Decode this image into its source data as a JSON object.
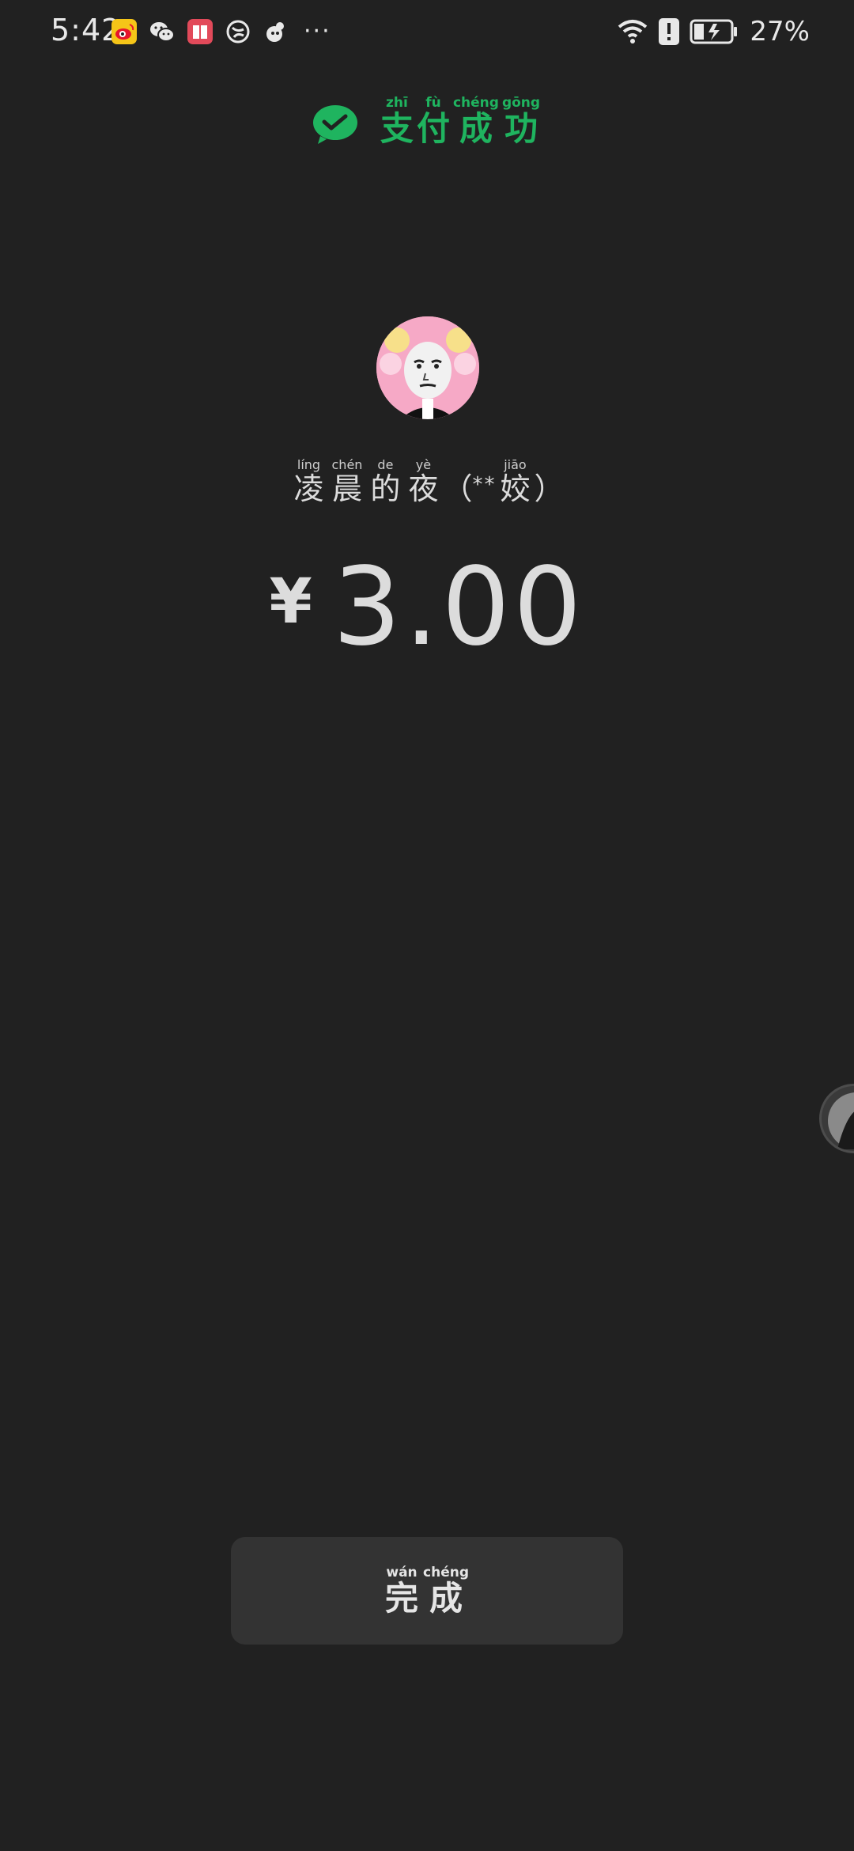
{
  "status_bar": {
    "time": "5:42",
    "more": "···",
    "battery_percent": "27%",
    "notification_icons": [
      "weibo-icon",
      "wechat-icon",
      "reader-icon",
      "browser-icon",
      "app-icon"
    ],
    "right_icons": [
      "wifi-icon",
      "alert-icon",
      "battery-charging-icon"
    ]
  },
  "header": {
    "chars": [
      {
        "py": "zhī",
        "hz": "支"
      },
      {
        "py": "fù",
        "hz": "付"
      },
      {
        "py": "chéng",
        "hz": "成"
      },
      {
        "py": "gōng",
        "hz": "功"
      }
    ],
    "icon": "wechat-pay-check-icon",
    "color": "#1fb45f"
  },
  "payee": {
    "chars": [
      {
        "py": "líng",
        "hz": "凌"
      },
      {
        "py": "chén",
        "hz": "晨"
      },
      {
        "py": "de",
        "hz": "的"
      },
      {
        "py": "yè",
        "hz": "夜"
      }
    ],
    "open_paren": "（",
    "mask": "**",
    "last": {
      "py": "jiāo",
      "hz": "姣"
    },
    "close_paren": "）"
  },
  "amount": {
    "currency": "¥",
    "value": "3.00"
  },
  "done_button": {
    "chars": [
      {
        "py": "wán",
        "hz": "完"
      },
      {
        "py": "chéng",
        "hz": "成"
      }
    ]
  },
  "colors": {
    "background": "#212121",
    "accent": "#1fb45f",
    "button": "#333333"
  }
}
